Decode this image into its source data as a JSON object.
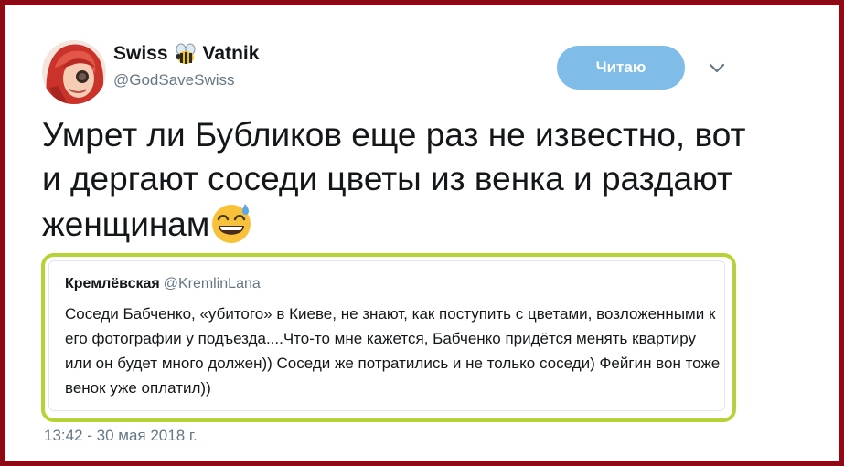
{
  "tweet": {
    "author_name": "Swiss",
    "author_name_suffix": "Vatnik",
    "name_emoji": "bee-icon",
    "handle": "@GodSaveSwiss",
    "follow_label": "Читаю",
    "menu_icon": "chevron-down-icon",
    "text": "Умрет ли Бубликов еще раз не известно, вот и дергают соседи цветы из венка и раздают женщинам",
    "text_emoji": "grinning-sweat-emoji-icon",
    "timestamp": "13:42 - 30 мая 2018 г."
  },
  "quote": {
    "author_name": "Кремлёвская",
    "handle": "@KremlinLana",
    "text": "Соседи Бабченко, «убитого» в Киеве, не знают, как поступить с цветами, возложенными к его фотографии у подъезда....Что-то мне кажется, Бабченко придётся менять квартиру или он будет много должен)) Соседи же потратились и не только соседи) Фейгин вон тоже венок уже оплатил))"
  },
  "colors": {
    "frame": "#8b0a16",
    "follow_button": "#7fbde8",
    "quote_highlight": "#b5d334",
    "secondary_text": "#657786"
  }
}
